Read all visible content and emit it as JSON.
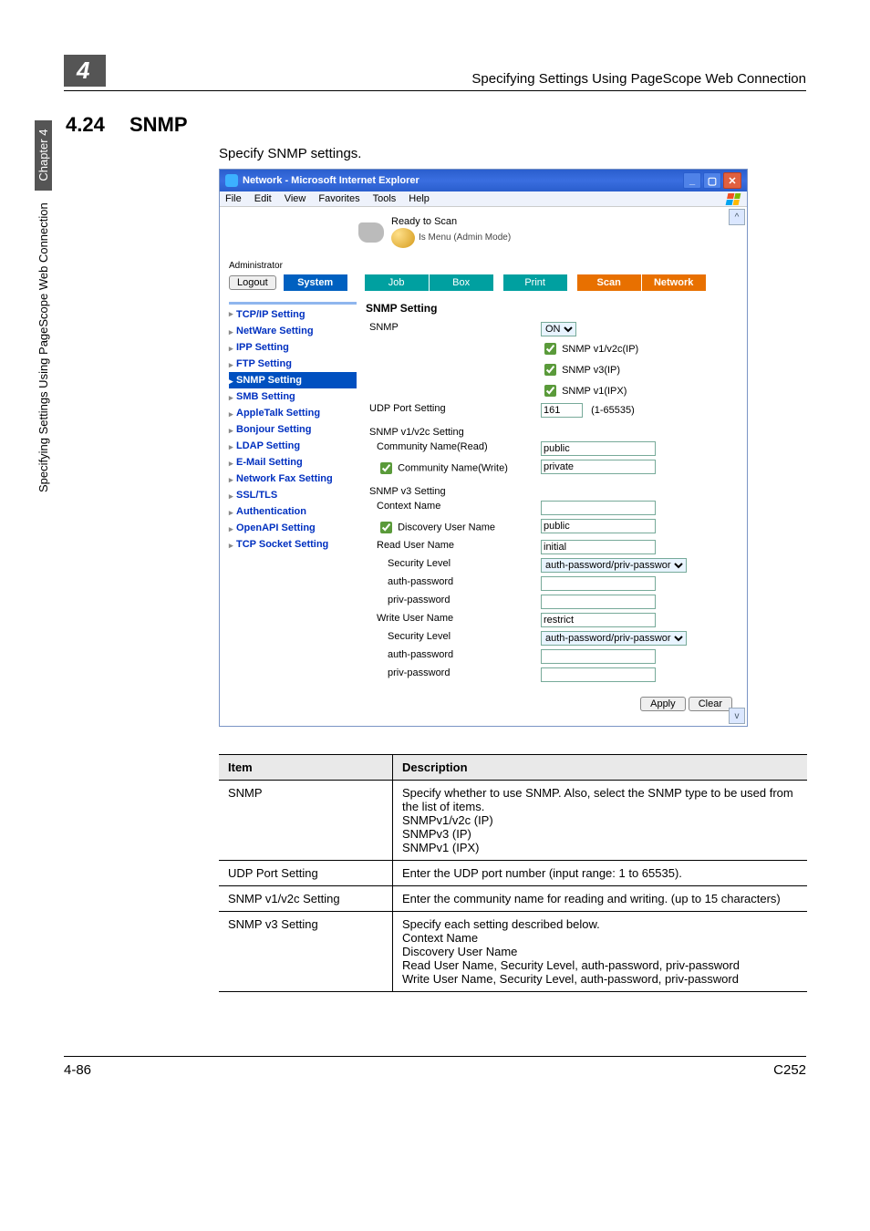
{
  "header": {
    "chapter_number": "4",
    "chapter_title": "Specifying Settings Using PageScope Web Connection"
  },
  "section": {
    "number": "4.24",
    "title": "SNMP",
    "intro": "Specify SNMP settings."
  },
  "sidetab": {
    "text": "Specifying Settings Using PageScope Web Connection",
    "chapter": "Chapter 4"
  },
  "footer": {
    "page": "4-86",
    "model": "C252"
  },
  "screenshot": {
    "titlebar": "Network - Microsoft Internet Explorer",
    "menus": [
      "File",
      "Edit",
      "View",
      "Favorites",
      "Tools",
      "Help"
    ],
    "banner": {
      "line1": "Ready to Scan",
      "line2": "Is Menu (Admin Mode)"
    },
    "admin_label": "Administrator",
    "logout": "Logout",
    "tabs": {
      "system": "System",
      "job": "Job",
      "box": "Box",
      "print": "Print",
      "scan": "Scan",
      "network": "Network"
    },
    "side_items": [
      {
        "label": "TCP/IP Setting",
        "topline": true
      },
      {
        "label": "NetWare Setting"
      },
      {
        "label": "IPP Setting"
      },
      {
        "label": "FTP Setting"
      },
      {
        "label": "SNMP Setting",
        "active": true
      },
      {
        "label": "SMB Setting"
      },
      {
        "label": "AppleTalk Setting"
      },
      {
        "label": "Bonjour Setting"
      },
      {
        "label": "LDAP Setting"
      },
      {
        "label": "E-Mail Setting"
      },
      {
        "label": "Network Fax Setting"
      },
      {
        "label": "SSL/TLS"
      },
      {
        "label": "Authentication"
      },
      {
        "label": "OpenAPI Setting"
      },
      {
        "label": "TCP Socket Setting"
      }
    ],
    "form": {
      "heading": "SNMP Setting",
      "snmp_label": "SNMP",
      "snmp_value": "ON",
      "snmp_opts": [
        {
          "label": "SNMP v1/v2c(IP)",
          "checked": true
        },
        {
          "label": "SNMP v3(IP)",
          "checked": true
        },
        {
          "label": "SNMP v1(IPX)",
          "checked": true
        }
      ],
      "udp_label": "UDP Port Setting",
      "udp_value": "161",
      "udp_range": "(1-65535)",
      "v1v2c_heading": "SNMP v1/v2c Setting",
      "comm_read_label": "Community Name(Read)",
      "comm_read_value": "public",
      "comm_write_label": "Community Name(Write)",
      "comm_write_checked": true,
      "comm_write_value": "private",
      "v3_heading": "SNMP v3 Setting",
      "context_label": "Context Name",
      "context_value": "",
      "discovery_label": "Discovery User Name",
      "discovery_checked": true,
      "discovery_value": "public",
      "read_user_label": "Read User Name",
      "read_user_value": "initial",
      "sec_level_label": "Security Level",
      "read_sec_value": "auth-password/priv-password",
      "authpw_label": "auth-password",
      "privpw_label": "priv-password",
      "write_user_label": "Write User Name",
      "write_user_value": "restrict",
      "write_sec_value": "auth-password/priv-password",
      "apply": "Apply",
      "clear": "Clear"
    }
  },
  "desc_table": {
    "head": {
      "item": "Item",
      "description": "Description"
    },
    "rows": [
      {
        "item": "SNMP",
        "desc": "Specify whether to use SNMP. Also, select the SNMP type to be used from the list of items.\nSNMPv1/v2c (IP)\nSNMPv3 (IP)\nSNMPv1 (IPX)"
      },
      {
        "item": "UDP Port Setting",
        "desc": "Enter the UDP port number (input range: 1 to 65535)."
      },
      {
        "item": "SNMP v1/v2c Setting",
        "desc": "Enter the community name for reading and writing. (up to 15 characters)"
      },
      {
        "item": "SNMP v3 Setting",
        "desc": "Specify each setting described below.\nContext Name\nDiscovery User Name\nRead User Name, Security Level, auth-password, priv-password\nWrite User Name, Security Level, auth-password, priv-password"
      }
    ]
  }
}
